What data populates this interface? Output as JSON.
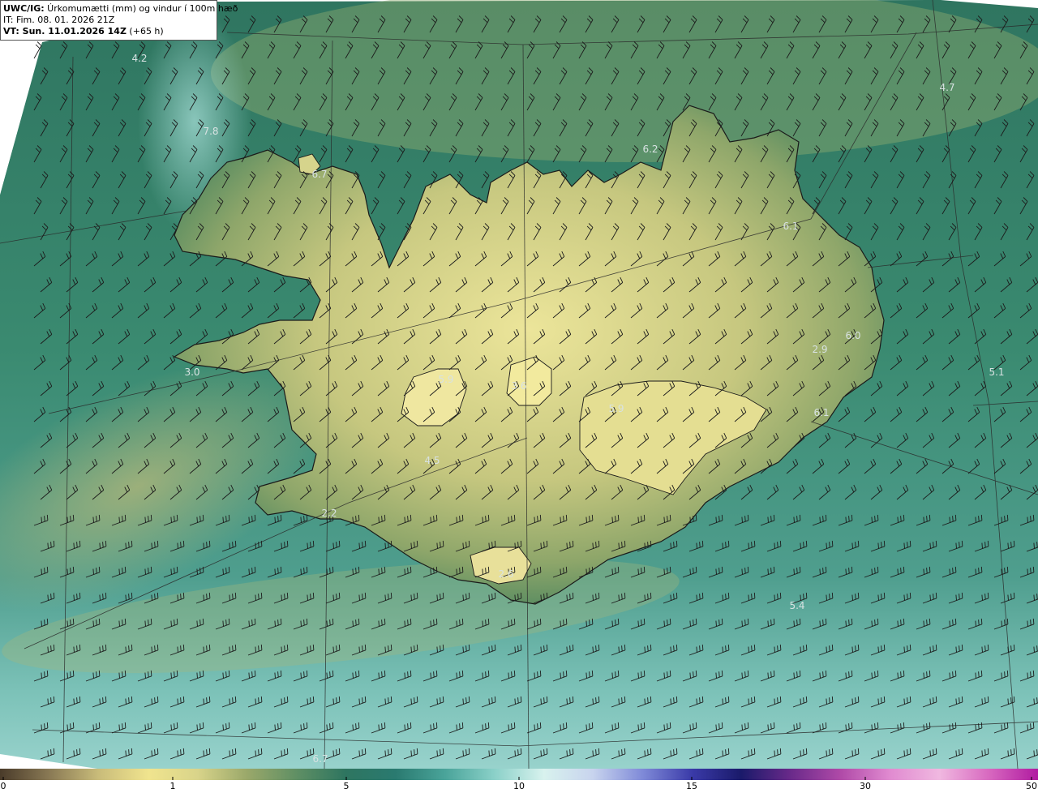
{
  "header": {
    "product_prefix": "UWC/IG:",
    "title": " Úrkomumætti (mm) og vindur í 100m hæð",
    "it_line": "IT: Fim. 08. 01. 2026 21Z",
    "vt_prefix": "VT: Sun. 11.01.2026 14Z",
    "vt_suffix": " (+65 h)"
  },
  "map_labels": [
    {
      "text": "4.2",
      "pos": [
        172,
        72
      ]
    },
    {
      "text": "7.8",
      "pos": [
        260,
        162
      ]
    },
    {
      "text": "6.7",
      "pos": [
        394,
        215
      ]
    },
    {
      "text": "6.2",
      "pos": [
        802,
        184
      ]
    },
    {
      "text": "4.7",
      "pos": [
        1168,
        108
      ]
    },
    {
      "text": "6.1",
      "pos": [
        975,
        279
      ]
    },
    {
      "text": "6.0",
      "pos": [
        1052,
        414
      ]
    },
    {
      "text": "2.9",
      "pos": [
        1011,
        431
      ]
    },
    {
      "text": "3.0",
      "pos": [
        237,
        459
      ]
    },
    {
      "text": "5.1",
      "pos": [
        1229,
        459
      ]
    },
    {
      "text": "5.9",
      "pos": [
        550,
        468
      ]
    },
    {
      "text": "3.6",
      "pos": [
        640,
        476
      ]
    },
    {
      "text": "5.9",
      "pos": [
        760,
        504
      ]
    },
    {
      "text": "6.1",
      "pos": [
        1013,
        509
      ]
    },
    {
      "text": "4.5",
      "pos": [
        533,
        568
      ]
    },
    {
      "text": "2.2",
      "pos": [
        406,
        633
      ]
    },
    {
      "text": "2.6",
      "pos": [
        624,
        708
      ]
    },
    {
      "text": "5.4",
      "pos": [
        983,
        747
      ]
    },
    {
      "text": "6.7",
      "pos": [
        395,
        936
      ]
    }
  ],
  "colorbar": {
    "ticks": [
      {
        "label": "0",
        "value": 0
      },
      {
        "label": "1",
        "value": 1
      },
      {
        "label": "5",
        "value": 5
      },
      {
        "label": "10",
        "value": 10
      },
      {
        "label": "15",
        "value": 15
      },
      {
        "label": "30",
        "value": 30
      },
      {
        "label": "50",
        "value": 50
      }
    ],
    "colors": [
      "#4a3b2a",
      "#8a7a55",
      "#c9bc7a",
      "#f0e48e",
      "#d9d48a",
      "#9aa86a",
      "#5f8f64",
      "#2e7560",
      "#2a7a70",
      "#4aa49a",
      "#8ad0c8",
      "#d8f2ee",
      "#c8d4ee",
      "#7f8ad8",
      "#3a3aa8",
      "#1a1a6a",
      "#6a2a8a",
      "#b04aa8",
      "#e08ad0",
      "#f0b8e0",
      "#d86ac0",
      "#b01aa0"
    ]
  },
  "colors": {
    "sea_dark": "#2a6e5c",
    "sea_light": "#6fb8b0",
    "land_high": "#eee69a",
    "land_mid": "#9fb06f",
    "coast_line": "#1a1a1a"
  }
}
